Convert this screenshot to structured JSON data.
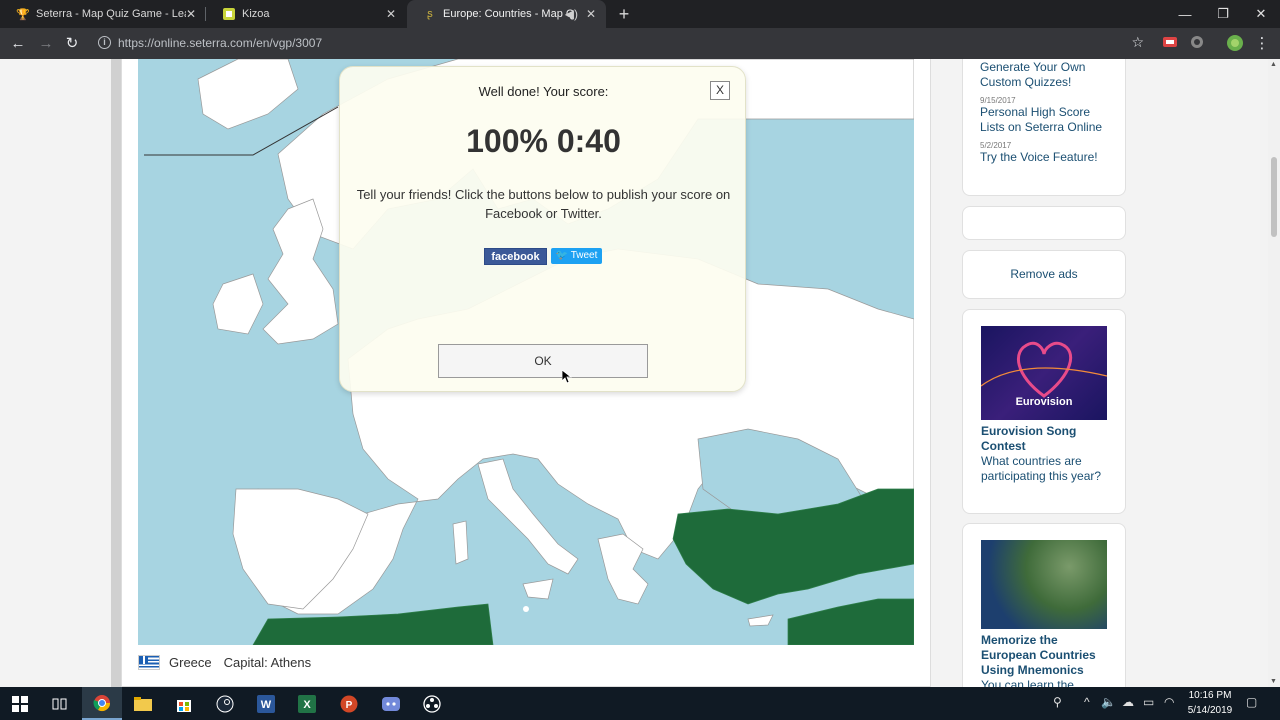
{
  "browser": {
    "tabs": [
      {
        "title": "Seterra - Map Quiz Game - Leader",
        "icon": "trophy-icon"
      },
      {
        "title": "Kizoa",
        "icon": "kizoa-icon"
      },
      {
        "title": "Europe: Countries - Map Qui",
        "icon": "seterra-icon",
        "active": true
      }
    ],
    "url": "https://online.seterra.com/en/vgp/3007",
    "window_controls": [
      "minimize",
      "maximize",
      "close"
    ]
  },
  "map": {
    "current_country": "Greece",
    "capital_label": "Capital: Athens"
  },
  "modal": {
    "heading": "Well done! Your score:",
    "score": "100% 0:40",
    "message": "Tell your friends! Click the buttons below to publish your score on Facebook or Twitter.",
    "facebook_label": "facebook",
    "tweet_label": "Tweet",
    "ok_label": "OK",
    "close_label": "X"
  },
  "sidebar": {
    "news": [
      {
        "title": "Generate Your Own Custom Quizzes!"
      },
      {
        "date": "9/15/2017",
        "title": "Personal High Score Lists on Seterra Online"
      },
      {
        "date": "5/2/2017",
        "title": "Try the Voice Feature!"
      }
    ],
    "remove_ads": "Remove ads",
    "promos": [
      {
        "title": "Eurovision Song Contest",
        "desc": "What countries are participating this year?",
        "image_text": "Eurovision"
      },
      {
        "title": "Memorize the European Countries Using Mnemonics",
        "desc": "You can learn the"
      }
    ]
  },
  "taskbar": {
    "time": "10:16 PM",
    "date": "5/14/2019"
  },
  "colors": {
    "sea": "#a7d4e1",
    "selected_country": "#1e6b3a",
    "link": "#1b4f72"
  }
}
